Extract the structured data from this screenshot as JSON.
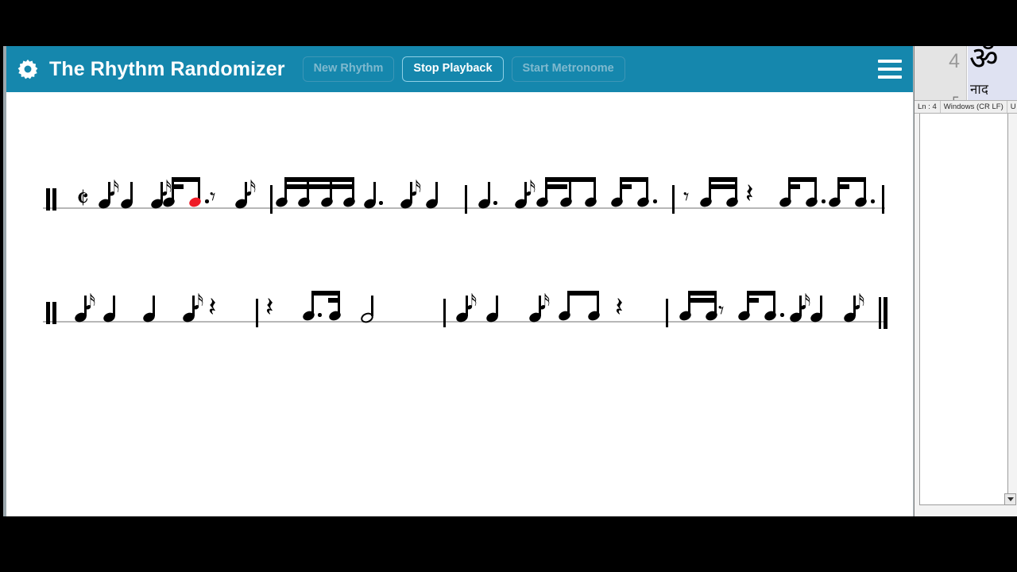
{
  "header": {
    "gear_icon": "gear-icon",
    "title": "The Rhythm Randomizer",
    "menu_icon": "hamburger-menu-icon",
    "accent_color": "#1587ad",
    "buttons": [
      {
        "label": "New Rhythm",
        "state": "inactive"
      },
      {
        "label": "Stop Playback",
        "state": "active"
      },
      {
        "label": "Start Metronome",
        "state": "inactive"
      }
    ]
  },
  "score": {
    "time_signature": "cut-common-time",
    "playing_note_color": "#ee1c27",
    "staff_line_color": "#b7b7b7",
    "staves": [
      {
        "index": 1,
        "start_barline": "thick-double",
        "end_barline": "single",
        "measures": [
          {
            "symbols": [
              "time-signature-cut-common",
              "eighth-note",
              "quarter-note",
              "eighth-note",
              "beamed-eighth-dotted-eighth",
              "eighth-rest",
              "eighth-note"
            ]
          },
          {
            "symbols": [
              "beamed-four-sixteenths",
              "dotted-quarter-note",
              "eighth-note",
              "quarter-note"
            ]
          },
          {
            "symbols": [
              "dotted-quarter-note",
              "eighth-note",
              "beamed-sixteenth-sixteenth-eighth",
              "beamed-sixteenth-dotted-eighth"
            ]
          },
          {
            "symbols": [
              "eighth-rest",
              "beamed-sixteenth-sixteenth",
              "quarter-rest",
              "beamed-sixteenth-dotted-eighth",
              "beamed-sixteenth-dotted-eighth"
            ]
          }
        ]
      },
      {
        "index": 2,
        "start_barline": "thick-double",
        "end_barline": "final-double",
        "measures": [
          {
            "symbols": [
              "eighth-note",
              "quarter-note",
              "quarter-note",
              "eighth-note",
              "quarter-rest"
            ]
          },
          {
            "symbols": [
              "quarter-rest",
              "beamed-dotted-eighth-sixteenth",
              "half-note"
            ]
          },
          {
            "symbols": [
              "eighth-note",
              "quarter-note",
              "eighth-note",
              "beamed-two-eighths",
              "quarter-rest"
            ]
          },
          {
            "symbols": [
              "beamed-sixteenth-sixteenth",
              "eighth-rest",
              "beamed-sixteenth-dotted-eighth",
              "eighth-note",
              "quarter-note",
              "eighth-note"
            ]
          }
        ]
      }
    ]
  },
  "editor_panel": {
    "line_number": "4",
    "document_text": "ॐ",
    "document_text_partial": "नाद",
    "gutter_bracket": "┌",
    "status": [
      {
        "label": "Ln : 4"
      },
      {
        "label": "Windows (CR LF)"
      },
      {
        "label": "U"
      }
    ],
    "scroll_down_icon": "scroll-down-arrow-icon"
  }
}
